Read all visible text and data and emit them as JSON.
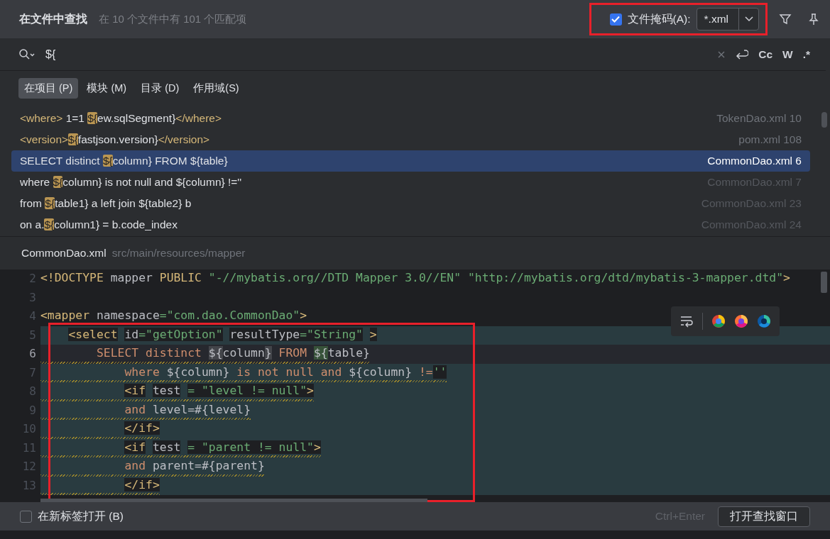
{
  "header": {
    "title": "在文件中查找",
    "summary": "在 10 个文件中有 101 个匹配项",
    "file_mask": {
      "checked": true,
      "label": "文件掩码(A):",
      "value": "*.xml",
      "outlined": true
    }
  },
  "search": {
    "value": "${",
    "options": [
      "Cc",
      "W",
      ".*"
    ]
  },
  "scopes": [
    {
      "label": "在项目 (P)",
      "selected": true
    },
    {
      "label": "模块 (M)",
      "selected": false
    },
    {
      "label": "目录 (D)",
      "selected": false
    },
    {
      "label": "作用域(S)",
      "selected": false
    }
  ],
  "results": [
    {
      "parts": [
        {
          "text": "<where>",
          "kind": "tag"
        },
        {
          "text": " 1=1 ",
          "kind": "plain"
        },
        {
          "text": "${",
          "kind": "match"
        },
        {
          "text": "ew.sqlSegment}",
          "kind": "plain"
        },
        {
          "text": "</where>",
          "kind": "tag"
        }
      ],
      "location": "TokenDao.xml 10",
      "selected": false,
      "dimmed": false
    },
    {
      "parts": [
        {
          "text": "<version>",
          "kind": "tag"
        },
        {
          "text": "${",
          "kind": "match"
        },
        {
          "text": "fastjson.version}",
          "kind": "plain"
        },
        {
          "text": "</version>",
          "kind": "tag"
        }
      ],
      "location": "pom.xml 108",
      "selected": false,
      "dimmed": false
    },
    {
      "parts": [
        {
          "text": "SELECT distinct ",
          "kind": "plain"
        },
        {
          "text": "${",
          "kind": "match"
        },
        {
          "text": "column} FROM ${table}",
          "kind": "plain"
        }
      ],
      "location": "CommonDao.xml 6",
      "selected": true,
      "dimmed": false
    },
    {
      "parts": [
        {
          "text": "where ",
          "kind": "plain"
        },
        {
          "text": "${",
          "kind": "match"
        },
        {
          "text": "column} is not null and ${column} !=''",
          "kind": "plain"
        }
      ],
      "location": "CommonDao.xml 7",
      "selected": false,
      "dimmed": true
    },
    {
      "parts": [
        {
          "text": "from ",
          "kind": "plain"
        },
        {
          "text": "${",
          "kind": "match"
        },
        {
          "text": "table1} a left join ${table2} b",
          "kind": "plain"
        }
      ],
      "location": "CommonDao.xml 23",
      "selected": false,
      "dimmed": true
    },
    {
      "parts": [
        {
          "text": "on a.",
          "kind": "plain"
        },
        {
          "text": "${",
          "kind": "match"
        },
        {
          "text": "column1} = b.code_index",
          "kind": "plain"
        }
      ],
      "location": "CommonDao.xml 24",
      "selected": false,
      "dimmed": true
    }
  ],
  "preview": {
    "file": "CommonDao.xml",
    "path": "src/main/resources/mapper"
  },
  "editor": {
    "outlined": true,
    "lines": [
      {
        "number": "2",
        "injected": false,
        "current": false,
        "warning": false,
        "tokens": [
          {
            "text": "<!DOCTYPE",
            "kind": "tag"
          },
          {
            "text": " mapper ",
            "kind": "plain"
          },
          {
            "text": "PUBLIC ",
            "kind": "tag"
          },
          {
            "text": "\"-//mybatis.org//DTD Mapper 3.0//EN\" ",
            "kind": "string"
          },
          {
            "text": "\"http://mybatis.org/dtd/mybatis-3-mapper.dtd\"",
            "kind": "string"
          },
          {
            "text": ">",
            "kind": "tag"
          }
        ]
      },
      {
        "number": "3",
        "injected": false,
        "current": false
      },
      {
        "number": "4",
        "injected": false,
        "current": false,
        "warning": false,
        "tokens": [
          {
            "text": "<mapper",
            "kind": "tag"
          },
          {
            "text": " namespace",
            "kind": "attr"
          },
          {
            "text": "=\"com.dao.CommonDao\"",
            "kind": "string"
          },
          {
            "text": ">",
            "kind": "tag"
          }
        ]
      },
      {
        "number": "5",
        "injected": true,
        "current": false,
        "warning": false,
        "tokens": [
          {
            "text": "    <select",
            "kind": "tag"
          },
          {
            "text": " id",
            "kind": "attr"
          },
          {
            "text": "=\"getOption\"",
            "kind": "string"
          },
          {
            "text": " resultType",
            "kind": "attr"
          },
          {
            "text": "=\"String\"",
            "kind": "string"
          },
          {
            "text": " >",
            "kind": "tag"
          }
        ]
      },
      {
        "number": "6",
        "injected": false,
        "current": true,
        "warning": true,
        "tokens": [
          {
            "text": "        SELECT distinct ",
            "kind": "keyword"
          },
          {
            "text": "${",
            "kind": "brace"
          },
          {
            "text": "column",
            "kind": "plain"
          },
          {
            "text": "}",
            "kind": "brace"
          },
          {
            "text": " FROM ",
            "kind": "keyword"
          },
          {
            "text": "${",
            "kind": "match"
          },
          {
            "text": "table}",
            "kind": "plain"
          }
        ]
      },
      {
        "number": "7",
        "injected": true,
        "current": false,
        "warning": true,
        "tokens": [
          {
            "text": "            where ",
            "kind": "keyword"
          },
          {
            "text": "${column}",
            "kind": "plain"
          },
          {
            "text": " is not null and ",
            "kind": "keyword"
          },
          {
            "text": "${column}",
            "kind": "plain"
          },
          {
            "text": " !=",
            "kind": "keyword"
          },
          {
            "text": "''",
            "kind": "string"
          }
        ]
      },
      {
        "number": "8",
        "injected": true,
        "current": false,
        "warning": true,
        "tokens": [
          {
            "text": "            <if",
            "kind": "tag"
          },
          {
            "text": " test",
            "kind": "attr"
          },
          {
            "text": " = \"level != null\"",
            "kind": "string"
          },
          {
            "text": ">",
            "kind": "tag"
          }
        ]
      },
      {
        "number": "9",
        "injected": true,
        "current": false,
        "warning": true,
        "tokens": [
          {
            "text": "            and ",
            "kind": "keyword"
          },
          {
            "text": "level=#{level}",
            "kind": "plain"
          }
        ]
      },
      {
        "number": "10",
        "injected": true,
        "current": false,
        "warning": true,
        "tokens": [
          {
            "text": "            </if>",
            "kind": "tag"
          }
        ]
      },
      {
        "number": "11",
        "injected": true,
        "current": false,
        "warning": true,
        "tokens": [
          {
            "text": "            <if",
            "kind": "tag"
          },
          {
            "text": " test",
            "kind": "attr"
          },
          {
            "text": " = \"parent != null\"",
            "kind": "string"
          },
          {
            "text": ">",
            "kind": "tag"
          }
        ]
      },
      {
        "number": "12",
        "injected": true,
        "current": false,
        "warning": true,
        "tokens": [
          {
            "text": "            and ",
            "kind": "keyword"
          },
          {
            "text": "parent=#{parent}",
            "kind": "plain"
          }
        ]
      },
      {
        "number": "13",
        "injected": true,
        "current": false,
        "warning": true,
        "tokens": [
          {
            "text": "            </if>",
            "kind": "tag"
          }
        ]
      }
    ]
  },
  "footer": {
    "new_tab": {
      "checked": false,
      "label": "在新标签打开 (B)"
    },
    "shortcut": "Ctrl+Enter",
    "button": "打开查找窗口"
  }
}
